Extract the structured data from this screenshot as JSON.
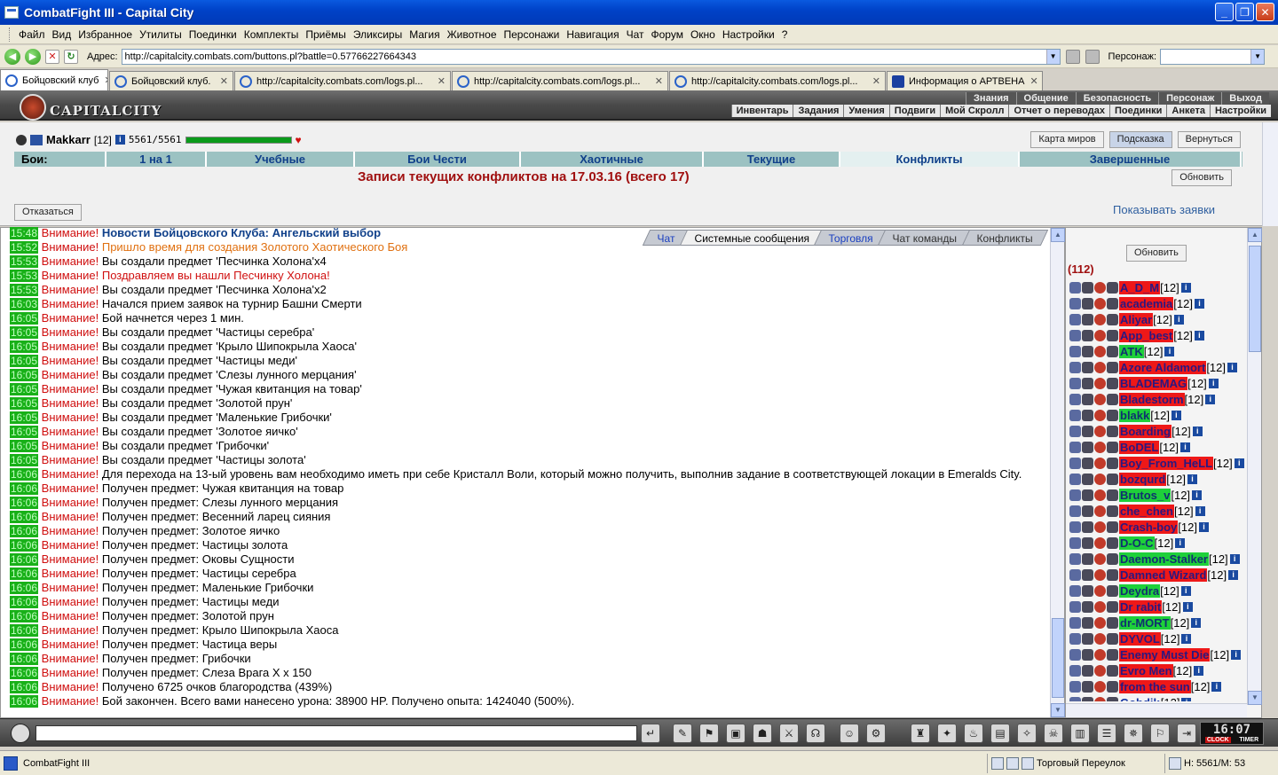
{
  "window": {
    "title": "CombatFight III - Capital City"
  },
  "menu": [
    "Файл",
    "Вид",
    "Избранное",
    "Утилиты",
    "Поединки",
    "Комплекты",
    "Приёмы",
    "Эликсиры",
    "Магия",
    "Животное",
    "Персонажи",
    "Навигация",
    "Чат",
    "Форум",
    "Окно",
    "Настройки",
    "?"
  ],
  "address": {
    "label": "Адрес:",
    "url": "http://capitalcity.combats.com/buttons.pl?battle=0.57766227664343",
    "persona_label": "Персонаж:"
  },
  "tabs": [
    {
      "label": "Бойцовский клуб",
      "active": true
    },
    {
      "label": "Бойцовский клуб."
    },
    {
      "label": "http://capitalcity.combats.com/logs.pl..."
    },
    {
      "label": "http://capitalcity.combats.com/logs.pl..."
    },
    {
      "label": "http://capitalcity.combats.com/logs.pl..."
    },
    {
      "label": "Информация о АРТВЕНА"
    }
  ],
  "banner": {
    "logo_text": "CAPITALCITY",
    "menu1": [
      "Знания",
      "Общение",
      "Безопасность",
      "Персонаж",
      "Выход"
    ],
    "menu2": [
      "Инвентарь",
      "Задания",
      "Умения",
      "Подвиги",
      "Мой Скролл",
      "Отчет о переводах",
      "Поединки",
      "Анкета",
      "Настройки"
    ]
  },
  "player": {
    "name": "Makkarr",
    "level": "[12]",
    "hp": "5561/5561",
    "hp_fraction": 1.0
  },
  "top_buttons": {
    "map": "Карта миров",
    "hint": "Подсказка",
    "back": "Вернуться"
  },
  "fights": {
    "label": "Бои:",
    "tabs": [
      "1 на 1",
      "Учебные",
      "Бои Чести",
      "Хаотичные",
      "Текущие",
      "Конфликты",
      "Завершенные"
    ],
    "active": "Конфликты",
    "title": "Записи текущих конфликтов на 17.03.16 (всего 17)",
    "refresh": "Обновить",
    "refuse": "Отказаться",
    "show_requests": "Показывать заявки"
  },
  "chat": {
    "tabs": [
      {
        "label": "Чат",
        "style": "blue"
      },
      {
        "label": "Системные сообщения",
        "style": "active"
      },
      {
        "label": "Торговля",
        "style": "blue"
      },
      {
        "label": "Чат команды",
        "style": ""
      },
      {
        "label": "Конфликты",
        "style": ""
      }
    ],
    "attention": "Внимание!",
    "lines": [
      {
        "time": "15:48",
        "text": "Новости Бойцовского Клуба: Ангельский выбор",
        "style": "news"
      },
      {
        "time": "15:52",
        "text": "Пришло время для создания Золотого Хаотического Боя",
        "style": "orange"
      },
      {
        "time": "15:53",
        "text": "Вы создали предмет 'Песчинка Холона'x4",
        "style": ""
      },
      {
        "time": "15:53",
        "text": "Поздравляем вы нашли Песчинку Холона!",
        "style": "red"
      },
      {
        "time": "15:53",
        "text": "Вы создали предмет 'Песчинка Холона'x2",
        "style": ""
      },
      {
        "time": "16:03",
        "text": "Начался прием заявок на турнир Башни Смерти",
        "style": ""
      },
      {
        "time": "16:05",
        "text": "Бой начнется через 1 мин.",
        "style": ""
      },
      {
        "time": "16:05",
        "text": "Вы создали предмет 'Частицы серебра'",
        "style": ""
      },
      {
        "time": "16:05",
        "text": "Вы создали предмет 'Крыло Шипокрыла Хаоса'",
        "style": ""
      },
      {
        "time": "16:05",
        "text": "Вы создали предмет 'Частицы меди'",
        "style": ""
      },
      {
        "time": "16:05",
        "text": "Вы создали предмет 'Слезы лунного мерцания'",
        "style": ""
      },
      {
        "time": "16:05",
        "text": "Вы создали предмет 'Чужая квитанция на товар'",
        "style": ""
      },
      {
        "time": "16:05",
        "text": "Вы создали предмет 'Золотой прун'",
        "style": ""
      },
      {
        "time": "16:05",
        "text": "Вы создали предмет 'Маленькие Грибочки'",
        "style": ""
      },
      {
        "time": "16:05",
        "text": "Вы создали предмет 'Золотое яичко'",
        "style": ""
      },
      {
        "time": "16:05",
        "text": "Вы создали предмет 'Грибочки'",
        "style": ""
      },
      {
        "time": "16:05",
        "text": "Вы создали предмет 'Частицы золота'",
        "style": ""
      },
      {
        "time": "16:06",
        "text": "Для перехода на 13-ый уровень вам необходимо иметь при себе Кристалл Воли, который можно получить, выполнив задание в соответствующей локации в Emeralds City.",
        "style": "",
        "wrap": true
      },
      {
        "time": "16:06",
        "text": "Получен предмет: Чужая квитанция на товар",
        "style": ""
      },
      {
        "time": "16:06",
        "text": "Получен предмет: Слезы лунного мерцания",
        "style": ""
      },
      {
        "time": "16:06",
        "text": "Получен предмет: Весенний ларец сияния",
        "style": ""
      },
      {
        "time": "16:06",
        "text": "Получен предмет: Золотое яичко",
        "style": ""
      },
      {
        "time": "16:06",
        "text": "Получен предмет: Частицы золота",
        "style": ""
      },
      {
        "time": "16:06",
        "text": "Получен предмет: Оковы Сущности",
        "style": ""
      },
      {
        "time": "16:06",
        "text": "Получен предмет: Частицы серебра",
        "style": ""
      },
      {
        "time": "16:06",
        "text": "Получен предмет: Маленькие Грибочки",
        "style": ""
      },
      {
        "time": "16:06",
        "text": "Получен предмет: Частицы меди",
        "style": ""
      },
      {
        "time": "16:06",
        "text": "Получен предмет: Золотой прун",
        "style": ""
      },
      {
        "time": "16:06",
        "text": "Получен предмет: Крыло Шипокрыла Хаоса",
        "style": ""
      },
      {
        "time": "16:06",
        "text": "Получен предмет: Частица веры",
        "style": ""
      },
      {
        "time": "16:06",
        "text": "Получен предмет: Грибочки",
        "style": ""
      },
      {
        "time": "16:06",
        "text": "Получен предмет: Слеза Врага X x 150",
        "style": ""
      },
      {
        "time": "16:06",
        "text": "Получено 6725 очков благородства (439%)",
        "style": ""
      },
      {
        "time": "16:06",
        "text": "Бой закончен. Всего вами нанесено урона: 38900 HP. Получено опыта: 1424040 (500%).",
        "style": ""
      }
    ]
  },
  "userlist": {
    "refresh": "Обновить",
    "count": "(112)",
    "users": [
      {
        "nick": "A_D_M",
        "level": "[12]",
        "color": "red"
      },
      {
        "nick": "academia",
        "level": "[12]",
        "color": "red"
      },
      {
        "nick": "Aliyar",
        "level": "[12]",
        "color": "red"
      },
      {
        "nick": "App_best",
        "level": "[12]",
        "color": "red"
      },
      {
        "nick": "ATK",
        "level": "[12]",
        "color": "green"
      },
      {
        "nick": "Azore Aldamort",
        "level": "[12]",
        "color": "red"
      },
      {
        "nick": "BLADEMAG",
        "level": "[12]",
        "color": "red"
      },
      {
        "nick": "Bladestorm",
        "level": "[12]",
        "color": "red"
      },
      {
        "nick": "blakk",
        "level": "[12]",
        "color": "green"
      },
      {
        "nick": "Boarding",
        "level": "[12]",
        "color": "red"
      },
      {
        "nick": "BoDEL",
        "level": "[12]",
        "color": "red"
      },
      {
        "nick": "Boy_From_HeLL",
        "level": "[12]",
        "color": "red"
      },
      {
        "nick": "bozqurd",
        "level": "[12]",
        "color": "red"
      },
      {
        "nick": "Brutos_v",
        "level": "[12]",
        "color": "green"
      },
      {
        "nick": "che_chen",
        "level": "[12]",
        "color": "red"
      },
      {
        "nick": "Crash-boy",
        "level": "[12]",
        "color": "red"
      },
      {
        "nick": "D-O-C",
        "level": "[12]",
        "color": "green"
      },
      {
        "nick": "Daemon-Stalker",
        "level": "[12]",
        "color": "green"
      },
      {
        "nick": "Damned Wizard",
        "level": "[12]",
        "color": "red"
      },
      {
        "nick": "Deydra",
        "level": "[12]",
        "color": "green"
      },
      {
        "nick": "Dr rabit",
        "level": "[12]",
        "color": "red"
      },
      {
        "nick": "dr-MORT",
        "level": "[12]",
        "color": "green"
      },
      {
        "nick": "DYVOL",
        "level": "[12]",
        "color": "red"
      },
      {
        "nick": "Enemy Must Die",
        "level": "[12]",
        "color": "red"
      },
      {
        "nick": "Evro Men",
        "level": "[12]",
        "color": "red"
      },
      {
        "nick": "from the sun",
        "level": "[12]",
        "color": "red"
      },
      {
        "nick": "Gobdik",
        "level": "[12]",
        "color": ""
      }
    ]
  },
  "clock": {
    "time": "16:07",
    "label1": "CLOCK",
    "label2": "TIMER"
  },
  "status": {
    "app": "CombatFight III",
    "location": "Торговый Переулок",
    "hp": "H: 5561/M: 53"
  }
}
